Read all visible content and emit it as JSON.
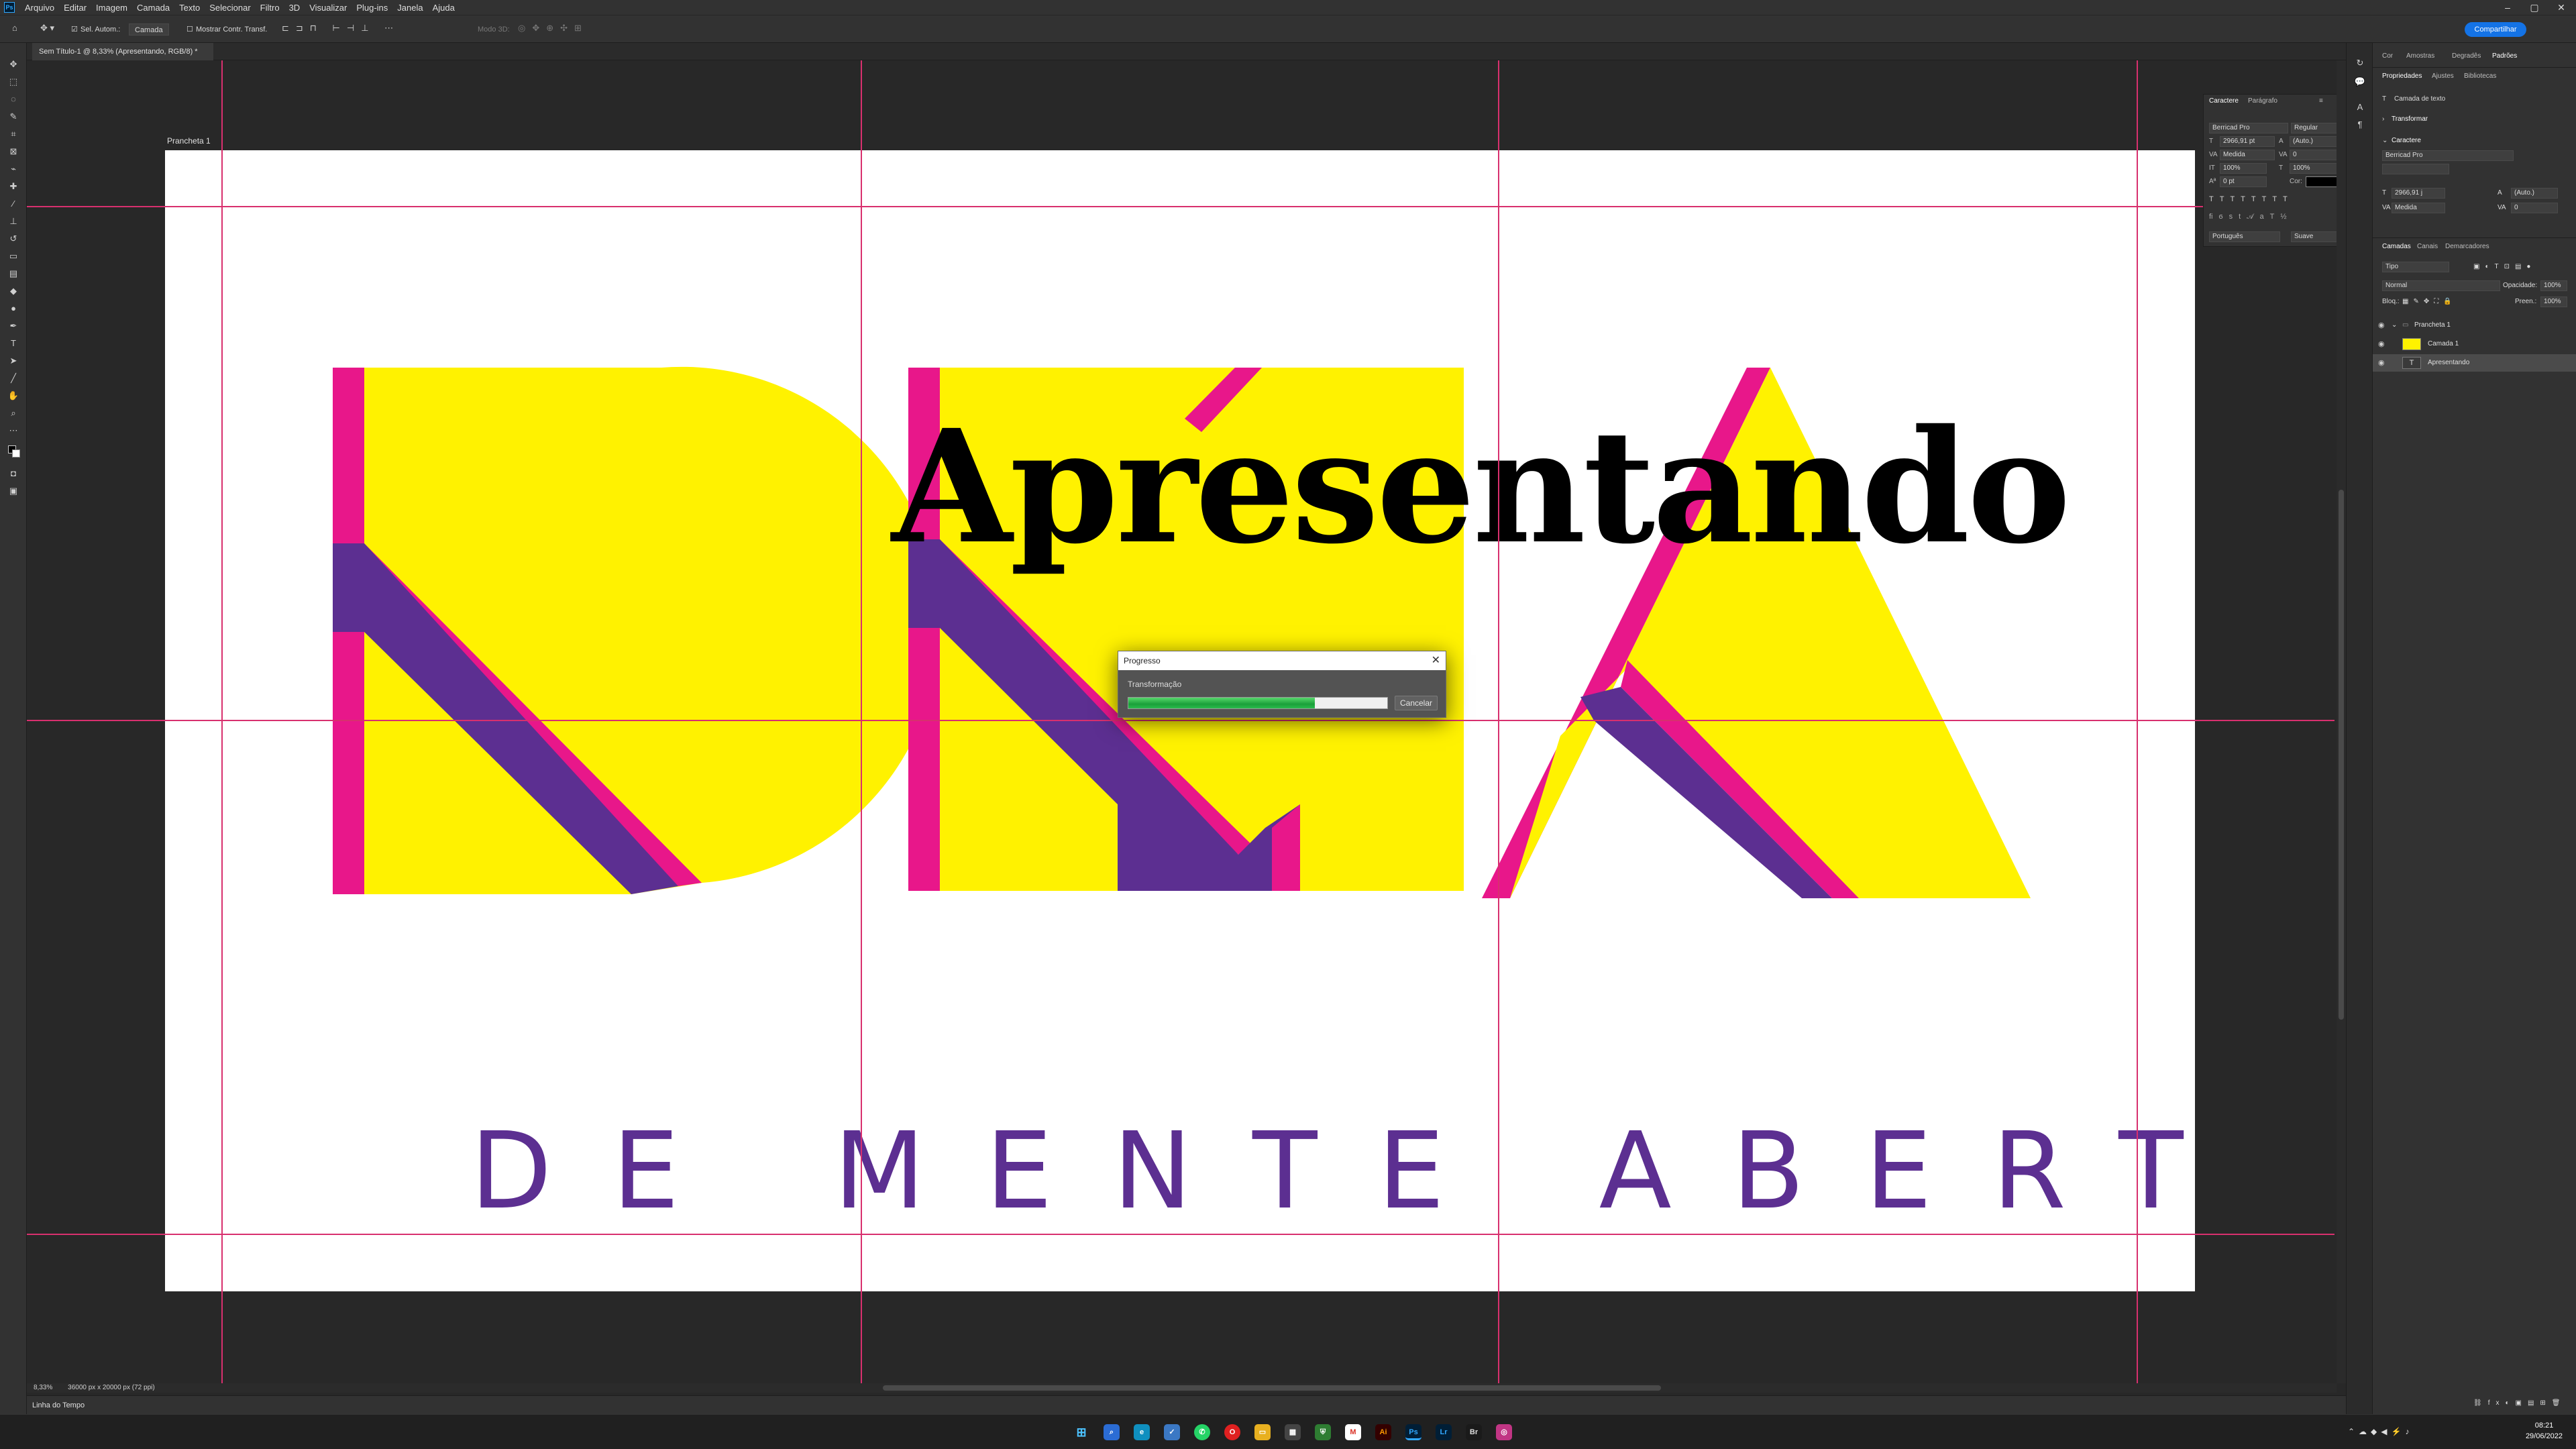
{
  "app": {
    "logo": "Ps",
    "menu": [
      "Arquivo",
      "Editar",
      "Imagem",
      "Camada",
      "Texto",
      "Selecionar",
      "Filtro",
      "3D",
      "Visualizar",
      "Plug-ins",
      "Janela",
      "Ajuda"
    ],
    "share_label": "Compartilhar",
    "icon_names": [
      "home-icon",
      "move-icon",
      "marquee-icon",
      "lasso-icon",
      "crop-icon",
      "brush-icon",
      "text-icon",
      "hand-icon",
      "zoom-icon"
    ]
  },
  "options": {
    "auto_select_label": "Sel. Autom.:",
    "auto_select_value": "Camada",
    "show_transform_label": "Mostrar Contr. Transf.",
    "mode_3d_label": "Modo 3D:"
  },
  "document": {
    "tab_title": "Sem Título-1 @ 8,33% (Apresentando, RGB/8) *",
    "artboard_name": "Prancheta 1",
    "headline": "Apresentando",
    "tagline": "DE MENTE ABERTA",
    "colors": {
      "yellow": "#fff200",
      "magenta": "#e8178a",
      "purple": "#5c2f91",
      "black": "#000000"
    }
  },
  "dialog": {
    "title": "Progresso",
    "operation": "Transformação",
    "progress": 0.72,
    "cancel_label": "Cancelar"
  },
  "character_panel": {
    "tabs": [
      "Caractere",
      "Parágrafo"
    ],
    "font_family": "Berricad Pro",
    "font_style": "Regular",
    "font_size": "2966,91 pt",
    "leading": "(Auto.)",
    "kerning": "Medida",
    "tracking": "0",
    "vertical_scale": "100%",
    "horizontal_scale": "100%",
    "baseline": "0 pt",
    "color_label": "Cor:",
    "language": "Português",
    "antialias": "Suave"
  },
  "right_panel": {
    "top_tabs": [
      "Cor",
      "Amostras",
      "Degradês",
      "Padrões"
    ],
    "prop_tabs": [
      "Propriedades",
      "Ajustes",
      "Bibliotecas"
    ],
    "layer_type": "Camada de texto",
    "transform_label": "Transformar",
    "character_label": "Caractere",
    "prop_font": "Berricad Pro",
    "prop_size": "2966,91 j",
    "prop_leading": "(Auto.)",
    "prop_kerning": "Medida",
    "prop_tracking": "0",
    "layers_tabs": [
      "Camadas",
      "Canais",
      "Demarcadores"
    ],
    "filter_label": "Tipo",
    "blend_mode": "Normal",
    "opacity_label": "Opacidade:",
    "opacity_value": "100%",
    "lock_label": "Bloq.:",
    "fill_label": "Preen.:",
    "fill_value": "100%",
    "layers": [
      "Prancheta 1",
      "Camada 1",
      "Apresentando"
    ]
  },
  "status": {
    "zoom": "8,33%",
    "doc_size": "36000 px x 20000 px (72 ppi)",
    "timeline": "Linha do Tempo"
  },
  "taskbar": {
    "time": "08:21",
    "date": "29/06/2022",
    "apps": [
      "windows",
      "search",
      "edge",
      "files",
      "whatsapp",
      "mail",
      "explorer",
      "photos",
      "shield",
      "gmail",
      "acrobat",
      "ps",
      "lr",
      "br",
      "instagram"
    ]
  }
}
